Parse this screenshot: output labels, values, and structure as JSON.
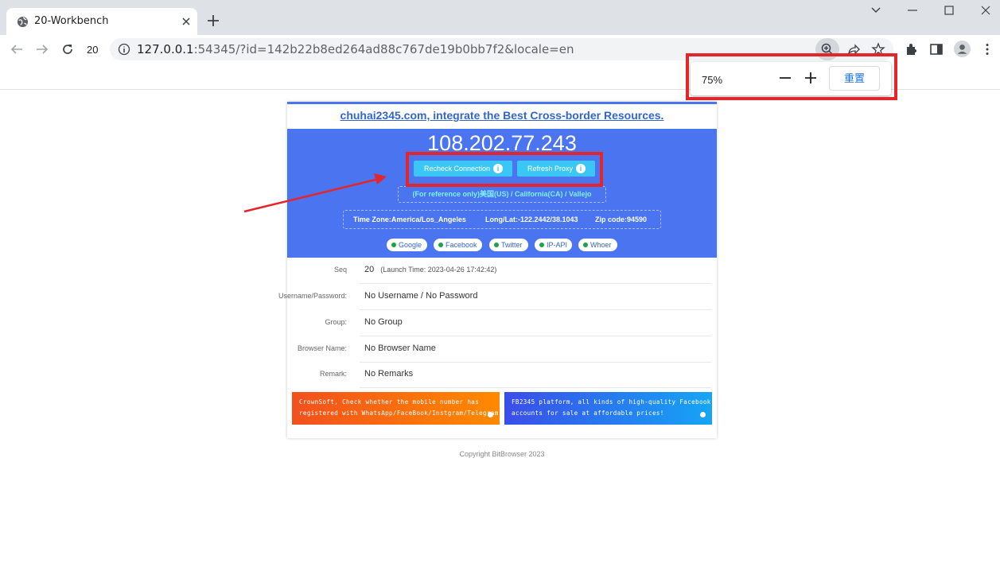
{
  "browser": {
    "tab_title": "20-Workbench",
    "toolbar_seq": "20",
    "url_host": "127.0.0.1",
    "url_rest": ":54345/?id=142b22b8ed264ad88c767de19b0bb7f2&locale=en"
  },
  "zoom_popup": {
    "percent": "75%",
    "reset_label": "重置"
  },
  "card": {
    "ad_link": "chuhai2345.com, integrate the Best Cross-border Resources.",
    "ip": "108.202.77.243",
    "recheck_label": "Recheck Connection",
    "refresh_label": "Refresh Proxy",
    "info_glyph": "i",
    "location": "(For reference only)美国(US) / California(CA) / Vallejo",
    "timezone": "Time Zone:America/Los_Angeles",
    "longlat": "Long/Lat:-122.2442/38.1043",
    "zipcode": "Zip code:94590",
    "links": [
      "Google",
      "Facebook",
      "Twitter",
      "IP-API",
      "Whoer"
    ],
    "rows": [
      {
        "label": "Seq",
        "value": "20",
        "sub": "(Launch Time: 2023-04-26 17:42:42)"
      },
      {
        "label": "Username/Password:",
        "value": "No Username / No Password"
      },
      {
        "label": "Group:",
        "value": "No Group"
      },
      {
        "label": "Browser Name:",
        "value": "No Browser Name"
      },
      {
        "label": "Remark:",
        "value": "No Remarks"
      }
    ],
    "banner_left": "CrownSoft, Check whether the mobile number has registered with WhatsApp/FaceBook/Instgram/Telegram",
    "banner_right": "FB2345 platform, all kinds of high-quality Facebook accounts for sale at affordable prices!"
  },
  "footer": "Copyright BitBrowser 2023",
  "colors": {
    "accent": "#4a74f0",
    "button": "#3bc7f5",
    "annotation": "#e3262b"
  }
}
